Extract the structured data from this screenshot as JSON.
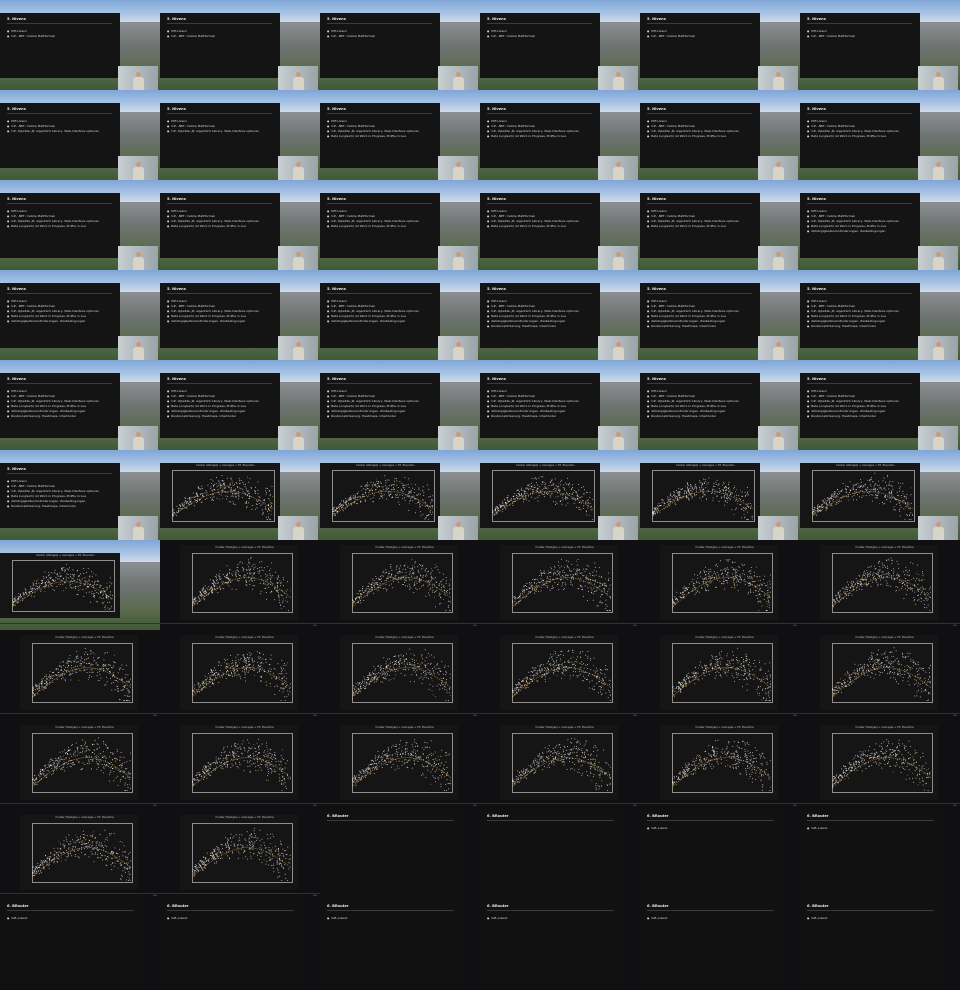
{
  "grid": {
    "columns": 6,
    "rows": 11,
    "tile_width": 160,
    "tile_height": 90
  },
  "slides": {
    "nivens": {
      "title": "5. Nivens",
      "bullets": [
        "MIT-Lizenz",
        "C#, .NET, mobile Plattformen",
        "C#, OjbeKte, JP, eigentlich Library, Web-Interface optional",
        "Beta (ungleich) ist Work in Progress, Profile in Lua",
        "Abhängigkeiten/Anforderungen, Zielbedingungen",
        "Routenoptimierung, Heatmaps, intermodal"
      ]
    },
    "brouter": {
      "title": "6. BRouter",
      "bullets": [
        "GPL-Lizenz"
      ]
    },
    "plot": {
      "title": "Cluster (Wedges) + Averages + Fit, Elevation"
    }
  },
  "tiles": [
    {
      "kind": "photo-slide",
      "bullets": 2
    },
    {
      "kind": "photo-slide",
      "bullets": 2
    },
    {
      "kind": "photo-slide",
      "bullets": 2
    },
    {
      "kind": "photo-slide",
      "bullets": 2
    },
    {
      "kind": "photo-slide",
      "bullets": 2
    },
    {
      "kind": "photo-slide",
      "bullets": 2
    },
    {
      "kind": "photo-slide",
      "bullets": 3
    },
    {
      "kind": "photo-slide",
      "bullets": 3
    },
    {
      "kind": "photo-slide",
      "bullets": 4
    },
    {
      "kind": "photo-slide",
      "bullets": 4
    },
    {
      "kind": "photo-slide",
      "bullets": 4
    },
    {
      "kind": "photo-slide",
      "bullets": 4
    },
    {
      "kind": "photo-slide",
      "bullets": 4
    },
    {
      "kind": "photo-slide",
      "bullets": 4
    },
    {
      "kind": "photo-slide",
      "bullets": 4
    },
    {
      "kind": "photo-slide",
      "bullets": 4
    },
    {
      "kind": "photo-slide",
      "bullets": 4
    },
    {
      "kind": "photo-slide",
      "bullets": 5
    },
    {
      "kind": "photo-slide",
      "bullets": 5
    },
    {
      "kind": "photo-slide",
      "bullets": 5
    },
    {
      "kind": "photo-slide",
      "bullets": 5
    },
    {
      "kind": "photo-slide",
      "bullets": 6
    },
    {
      "kind": "photo-slide",
      "bullets": 6
    },
    {
      "kind": "photo-slide",
      "bullets": 6
    },
    {
      "kind": "photo-slide",
      "bullets": 6
    },
    {
      "kind": "photo-slide",
      "bullets": 6
    },
    {
      "kind": "photo-slide",
      "bullets": 6
    },
    {
      "kind": "photo-slide",
      "bullets": 6
    },
    {
      "kind": "photo-slide",
      "bullets": 6
    },
    {
      "kind": "photo-slide",
      "bullets": 6
    },
    {
      "kind": "photo-slide",
      "bullets": 6
    },
    {
      "kind": "photo-plot"
    },
    {
      "kind": "photo-plot"
    },
    {
      "kind": "photo-plot"
    },
    {
      "kind": "photo-plot"
    },
    {
      "kind": "photo-plot"
    },
    {
      "kind": "photo-plot-small"
    },
    {
      "kind": "plot"
    },
    {
      "kind": "plot"
    },
    {
      "kind": "plot"
    },
    {
      "kind": "plot"
    },
    {
      "kind": "plot"
    },
    {
      "kind": "plot"
    },
    {
      "kind": "plot"
    },
    {
      "kind": "plot"
    },
    {
      "kind": "plot"
    },
    {
      "kind": "plot"
    },
    {
      "kind": "plot"
    },
    {
      "kind": "plot"
    },
    {
      "kind": "plot"
    },
    {
      "kind": "plot"
    },
    {
      "kind": "plot"
    },
    {
      "kind": "plot"
    },
    {
      "kind": "plot"
    },
    {
      "kind": "plot"
    },
    {
      "kind": "plot"
    },
    {
      "kind": "brouter",
      "bullets": 0
    },
    {
      "kind": "brouter",
      "bullets": 0
    },
    {
      "kind": "brouter",
      "bullets": 1
    },
    {
      "kind": "brouter",
      "bullets": 1
    },
    {
      "kind": "brouter",
      "bullets": 1
    },
    {
      "kind": "brouter",
      "bullets": 1
    },
    {
      "kind": "brouter",
      "bullets": 1
    },
    {
      "kind": "brouter",
      "bullets": 1
    },
    {
      "kind": "brouter",
      "bullets": 1
    },
    {
      "kind": "brouter",
      "bullets": 1
    }
  ],
  "colors": {
    "slide_bg": "#141414",
    "plot_points": "#ffffff",
    "plot_fit": "#d89a3a",
    "pager": "#3b6ec8"
  }
}
